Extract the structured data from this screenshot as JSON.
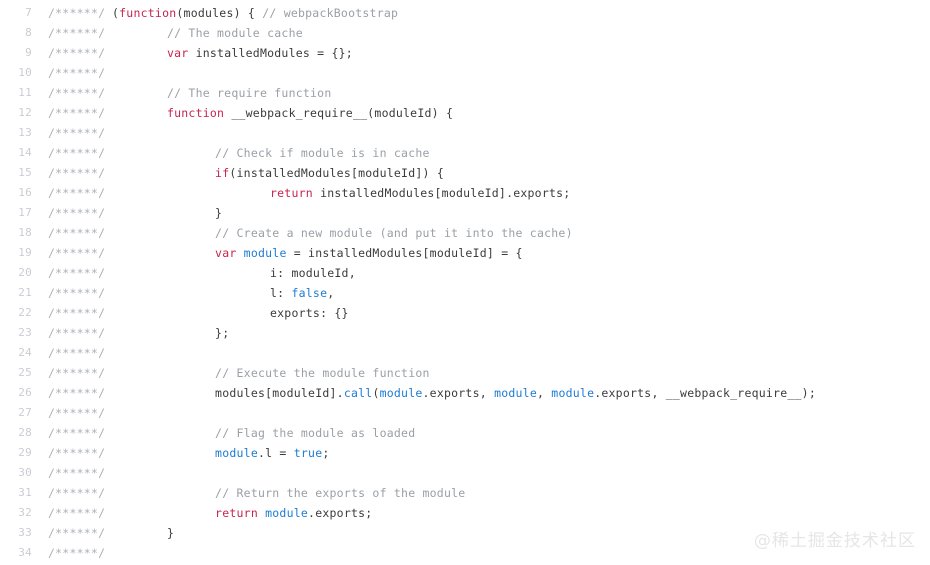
{
  "viewer": {
    "gutter_marker": "/******/",
    "first_line_number": 7,
    "watermark": "@稀土掘金技术社区",
    "colors": {
      "background": "#ffffff",
      "keyword": "#c7254e",
      "identifier": "#1c7cd6",
      "comment": "#9aa0a6",
      "plain": "#3b3b3b",
      "line_number": "#c9cdd2",
      "gutter_marker": "#adb2b8",
      "watermark": "#e6e6e6"
    }
  },
  "lines": [
    {
      "n": "7",
      "marker": "/******/",
      "indent": 0,
      "tokens": [
        {
          "t": "plain",
          "s": "("
        },
        {
          "t": "kw",
          "s": "function"
        },
        {
          "t": "plain",
          "s": "(modules) { "
        },
        {
          "t": "comment",
          "s": "// webpackBootstrap"
        }
      ]
    },
    {
      "n": "8",
      "marker": "/******/",
      "indent": 8,
      "tokens": [
        {
          "t": "comment",
          "s": "// The module cache"
        }
      ]
    },
    {
      "n": "9",
      "marker": "/******/",
      "indent": 8,
      "tokens": [
        {
          "t": "kw",
          "s": "var"
        },
        {
          "t": "plain",
          "s": " installedModules = {};"
        }
      ]
    },
    {
      "n": "10",
      "marker": "/******/",
      "indent": 0,
      "tokens": []
    },
    {
      "n": "11",
      "marker": "/******/",
      "indent": 8,
      "tokens": [
        {
          "t": "comment",
          "s": "// The require function"
        }
      ]
    },
    {
      "n": "12",
      "marker": "/******/",
      "indent": 8,
      "tokens": [
        {
          "t": "kw",
          "s": "function"
        },
        {
          "t": "plain",
          "s": " __webpack_require__(moduleId) {"
        }
      ]
    },
    {
      "n": "13",
      "marker": "/******/",
      "indent": 0,
      "tokens": []
    },
    {
      "n": "14",
      "marker": "/******/",
      "indent": 15,
      "tokens": [
        {
          "t": "comment",
          "s": "// Check if module is in cache"
        }
      ]
    },
    {
      "n": "15",
      "marker": "/******/",
      "indent": 15,
      "tokens": [
        {
          "t": "kw",
          "s": "if"
        },
        {
          "t": "plain",
          "s": "(installedModules[moduleId]) {"
        }
      ]
    },
    {
      "n": "16",
      "marker": "/******/",
      "indent": 23,
      "tokens": [
        {
          "t": "kw",
          "s": "return"
        },
        {
          "t": "plain",
          "s": " installedModules[moduleId].exports;"
        }
      ]
    },
    {
      "n": "17",
      "marker": "/******/",
      "indent": 15,
      "tokens": [
        {
          "t": "plain",
          "s": "}"
        }
      ]
    },
    {
      "n": "18",
      "marker": "/******/",
      "indent": 15,
      "tokens": [
        {
          "t": "comment",
          "s": "// Create a new module (and put it into the cache)"
        }
      ]
    },
    {
      "n": "19",
      "marker": "/******/",
      "indent": 15,
      "tokens": [
        {
          "t": "kw",
          "s": "var"
        },
        {
          "t": "plain",
          "s": " "
        },
        {
          "t": "ident",
          "s": "module"
        },
        {
          "t": "plain",
          "s": " = installedModules[moduleId] = {"
        }
      ]
    },
    {
      "n": "20",
      "marker": "/******/",
      "indent": 23,
      "tokens": [
        {
          "t": "plain",
          "s": "i: moduleId,"
        }
      ]
    },
    {
      "n": "21",
      "marker": "/******/",
      "indent": 23,
      "tokens": [
        {
          "t": "plain",
          "s": "l: "
        },
        {
          "t": "ident",
          "s": "false"
        },
        {
          "t": "plain",
          "s": ","
        }
      ]
    },
    {
      "n": "22",
      "marker": "/******/",
      "indent": 23,
      "tokens": [
        {
          "t": "plain",
          "s": "exports: {}"
        }
      ]
    },
    {
      "n": "23",
      "marker": "/******/",
      "indent": 15,
      "tokens": [
        {
          "t": "plain",
          "s": "};"
        }
      ]
    },
    {
      "n": "24",
      "marker": "/******/",
      "indent": 0,
      "tokens": []
    },
    {
      "n": "25",
      "marker": "/******/",
      "indent": 15,
      "tokens": [
        {
          "t": "comment",
          "s": "// Execute the module function"
        }
      ]
    },
    {
      "n": "26",
      "marker": "/******/",
      "indent": 15,
      "tokens": [
        {
          "t": "plain",
          "s": "modules[moduleId]."
        },
        {
          "t": "ident",
          "s": "call"
        },
        {
          "t": "plain",
          "s": "("
        },
        {
          "t": "ident",
          "s": "module"
        },
        {
          "t": "plain",
          "s": ".exports, "
        },
        {
          "t": "ident",
          "s": "module"
        },
        {
          "t": "plain",
          "s": ", "
        },
        {
          "t": "ident",
          "s": "module"
        },
        {
          "t": "plain",
          "s": ".exports, __webpack_require__);"
        }
      ]
    },
    {
      "n": "27",
      "marker": "/******/",
      "indent": 0,
      "tokens": []
    },
    {
      "n": "28",
      "marker": "/******/",
      "indent": 15,
      "tokens": [
        {
          "t": "comment",
          "s": "// Flag the module as loaded"
        }
      ]
    },
    {
      "n": "29",
      "marker": "/******/",
      "indent": 15,
      "tokens": [
        {
          "t": "ident",
          "s": "module"
        },
        {
          "t": "plain",
          "s": ".l = "
        },
        {
          "t": "ident",
          "s": "true"
        },
        {
          "t": "plain",
          "s": ";"
        }
      ]
    },
    {
      "n": "30",
      "marker": "/******/",
      "indent": 0,
      "tokens": []
    },
    {
      "n": "31",
      "marker": "/******/",
      "indent": 15,
      "tokens": [
        {
          "t": "comment",
          "s": "// Return the exports of the module"
        }
      ]
    },
    {
      "n": "32",
      "marker": "/******/",
      "indent": 15,
      "tokens": [
        {
          "t": "kw",
          "s": "return"
        },
        {
          "t": "plain",
          "s": " "
        },
        {
          "t": "ident",
          "s": "module"
        },
        {
          "t": "plain",
          "s": ".exports;"
        }
      ]
    },
    {
      "n": "33",
      "marker": "/******/",
      "indent": 8,
      "tokens": [
        {
          "t": "plain",
          "s": "}"
        }
      ]
    },
    {
      "n": "34",
      "marker": "/******/",
      "indent": 0,
      "tokens": []
    }
  ]
}
